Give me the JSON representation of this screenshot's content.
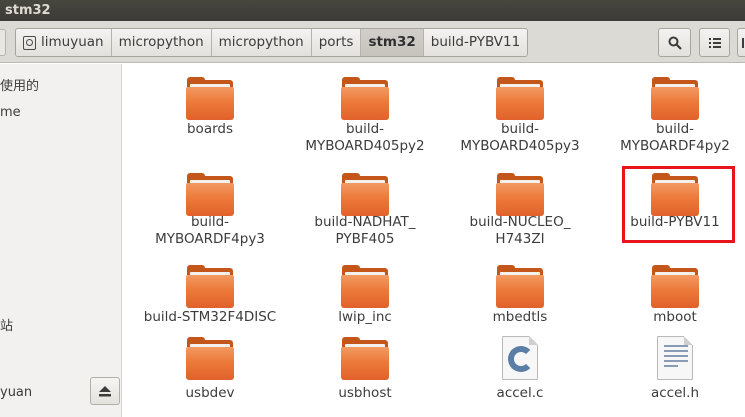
{
  "window": {
    "title": "stm32"
  },
  "pathbar": {
    "crumbs": [
      "limuyuan",
      "micropython",
      "micropython",
      "ports",
      "stm32",
      "build-PYBV11"
    ],
    "active_index": 4
  },
  "sidebar": {
    "items": [
      "使用的",
      "me",
      "站",
      "yuan"
    ]
  },
  "files": [
    {
      "name": "boards",
      "kind": "folder"
    },
    {
      "name": "build-\nMYBOARD405py2",
      "kind": "folder"
    },
    {
      "name": "build-\nMYBOARD405py3",
      "kind": "folder"
    },
    {
      "name": "build-\nMYBOARDF4py2",
      "kind": "folder"
    },
    {
      "name": "build-\nMYBOARDF4py3",
      "kind": "folder"
    },
    {
      "name": "build-NADHAT_\nPYBF405",
      "kind": "folder"
    },
    {
      "name": "build-NUCLEO_\nH743ZI",
      "kind": "folder"
    },
    {
      "name": "build-PYBV11",
      "kind": "folder"
    },
    {
      "name": "build-STM32F4DISC",
      "kind": "folder"
    },
    {
      "name": "lwip_inc",
      "kind": "folder"
    },
    {
      "name": "mbedtls",
      "kind": "folder"
    },
    {
      "name": "mboot",
      "kind": "folder"
    },
    {
      "name": "usbdev",
      "kind": "folder"
    },
    {
      "name": "usbhost",
      "kind": "folder"
    },
    {
      "name": "accel.c",
      "kind": "c-source"
    },
    {
      "name": "accel.h",
      "kind": "c-header"
    }
  ],
  "colors": {
    "highlight": "#e8141c",
    "folder": "#ec7a3a"
  }
}
